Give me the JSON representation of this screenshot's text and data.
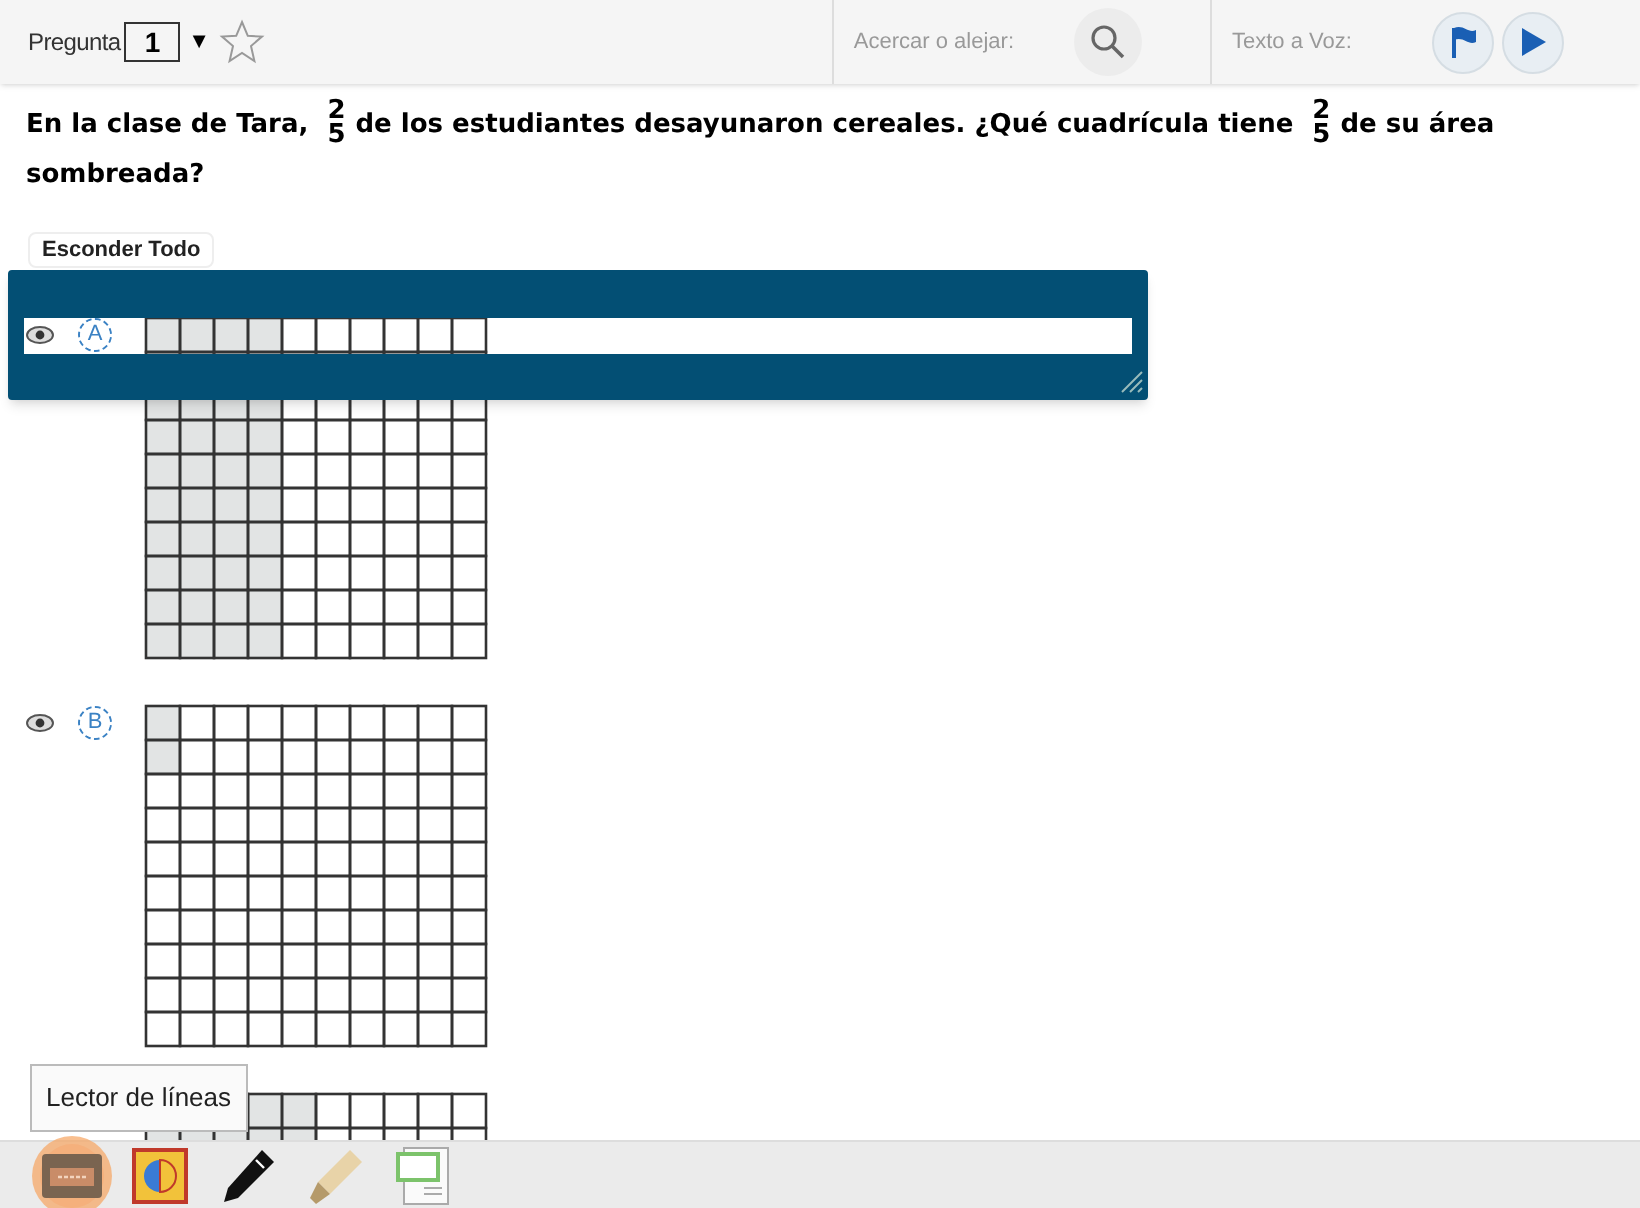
{
  "toolbar": {
    "question_label": "Pregunta",
    "question_number": "1",
    "dropdown_glyph": "▼",
    "zoom_label": "Acercar o alejar:",
    "tts_label": "Texto a Voz:"
  },
  "question": {
    "parts": [
      {
        "kind": "text",
        "text": "En la clase de Tara,"
      },
      {
        "kind": "fraction",
        "numerator": "2",
        "denominator": "5"
      },
      {
        "kind": "text",
        "text": "de los estudiantes desayunaron cereales. ¿Qué cuadrícula tiene"
      },
      {
        "kind": "fraction",
        "numerator": "2",
        "denominator": "5"
      },
      {
        "kind": "text",
        "text": "de su área sombreada?"
      }
    ]
  },
  "hide_all_button": "Esconder Todo",
  "options": [
    {
      "label": "A",
      "kind": "columns",
      "level": 0.4
    },
    {
      "label": "B",
      "kind": "columns",
      "level": 0.02
    },
    {
      "kind": "columns",
      "level": 0.5
    }
  ],
  "line_reader": {
    "on": true
  },
  "tooltip": "Lector de líneas",
  "tools": [
    {
      "kind": "line-reader",
      "selected": true
    },
    {
      "kind": "contrast",
      "selected": false
    },
    {
      "kind": "pen",
      "selected": false
    },
    {
      "kind": "highlighter",
      "selected": false
    },
    {
      "kind": "note",
      "selected": false
    }
  ]
}
